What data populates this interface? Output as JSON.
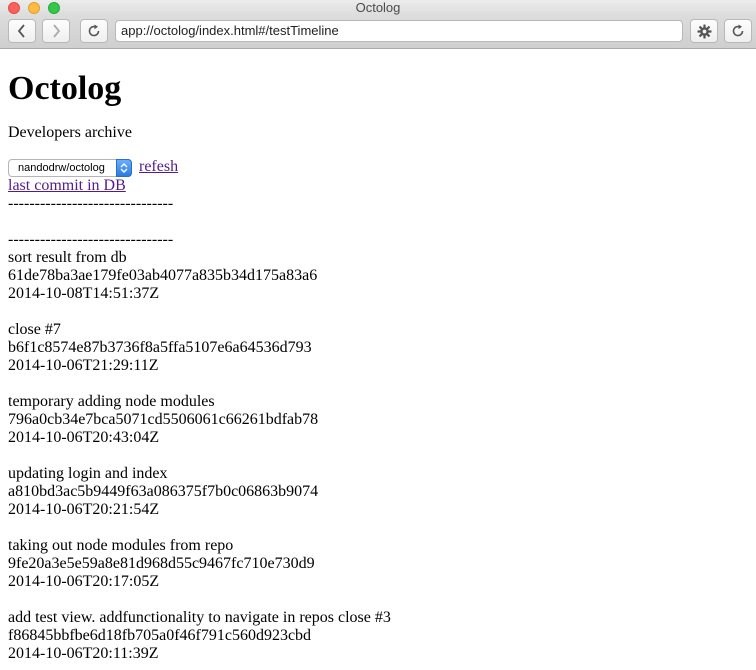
{
  "window": {
    "title": "Octolog"
  },
  "toolbar": {
    "url": "app://octolog/index.html#/testTimeline"
  },
  "page": {
    "heading": "Octolog",
    "subtitle": "Developers archive",
    "repo_select": {
      "selected": "nandodrw/octolog"
    },
    "refresh_link": "refesh",
    "last_commit_link": "last commit in DB",
    "separator": "-------------------------------"
  },
  "commits": [
    {
      "message": "sort result from db",
      "sha": "61de78ba3ae179fe03ab4077a835b34d175a83a6",
      "date": "2014-10-08T14:51:37Z"
    },
    {
      "message": "close #7",
      "sha": "b6f1c8574e87b3736f8a5ffa5107e6a64536d793",
      "date": "2014-10-06T21:29:11Z"
    },
    {
      "message": "temporary adding node modules",
      "sha": "796a0cb34e7bca5071cd5506061c66261bdfab78",
      "date": "2014-10-06T20:43:04Z"
    },
    {
      "message": "updating login and index",
      "sha": "a810bd3ac5b9449f63a086375f7b0c06863b9074",
      "date": "2014-10-06T20:21:54Z"
    },
    {
      "message": "taking out node modules from repo",
      "sha": "9fe20a3e5e59a8e81d968d55c9467fc710e730d9",
      "date": "2014-10-06T20:17:05Z"
    },
    {
      "message": "add test view. addfunctionality to navigate in repos close #3",
      "sha": "f86845bbfbe6d18fb705a0f46f791c560d923cbd",
      "date": "2014-10-06T20:11:39Z"
    }
  ]
}
